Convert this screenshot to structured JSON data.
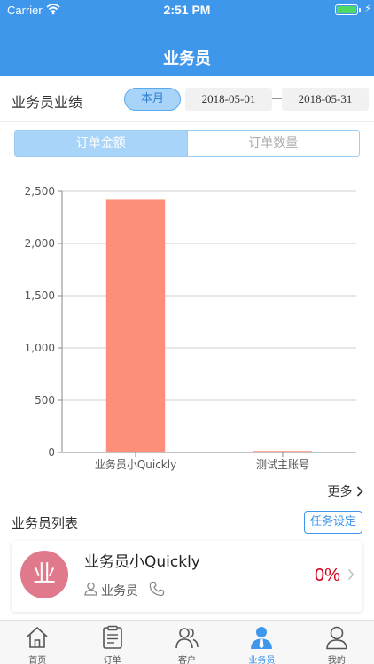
{
  "status_bar": {
    "carrier": "Carrier",
    "time": "2:51 PM",
    "battery_level": 1.0,
    "battery_color": "#4cd964"
  },
  "nav": {
    "title": "业务员"
  },
  "performance": {
    "label": "业务员业绩",
    "period_button": "本月",
    "start_date": "2018-05-01",
    "end_date": "2018-05-31"
  },
  "segmented": {
    "amount_label": "订单金额",
    "count_label": "订单数量",
    "selected": "amount"
  },
  "chart_data": {
    "type": "bar",
    "categories": [
      "业务员小Quickly",
      "测试主账号"
    ],
    "values": [
      2420,
      15
    ],
    "yticks": [
      "0",
      "500",
      "1,000",
      "1,500",
      "2,000",
      "2,500"
    ],
    "ylim": [
      0,
      2500
    ],
    "bar_color": "#fd8e79",
    "grid": true
  },
  "more_label": "更多",
  "list": {
    "label": "业务员列表",
    "task_button": "任务设定",
    "items": [
      {
        "avatar_text": "业",
        "avatar_color": "#e0798c",
        "name": "业务员小Quickly",
        "role": "业务员",
        "percent": "0%"
      }
    ]
  },
  "tabs": [
    {
      "label": "首页",
      "icon": "home-icon"
    },
    {
      "label": "订单",
      "icon": "order-icon"
    },
    {
      "label": "客户",
      "icon": "customers-icon"
    },
    {
      "label": "业务员",
      "icon": "salesperson-icon",
      "active": true
    },
    {
      "label": "我的",
      "icon": "profile-icon"
    }
  ],
  "colors": {
    "primary": "#3e97ea",
    "accent_red": "#d0021b"
  }
}
